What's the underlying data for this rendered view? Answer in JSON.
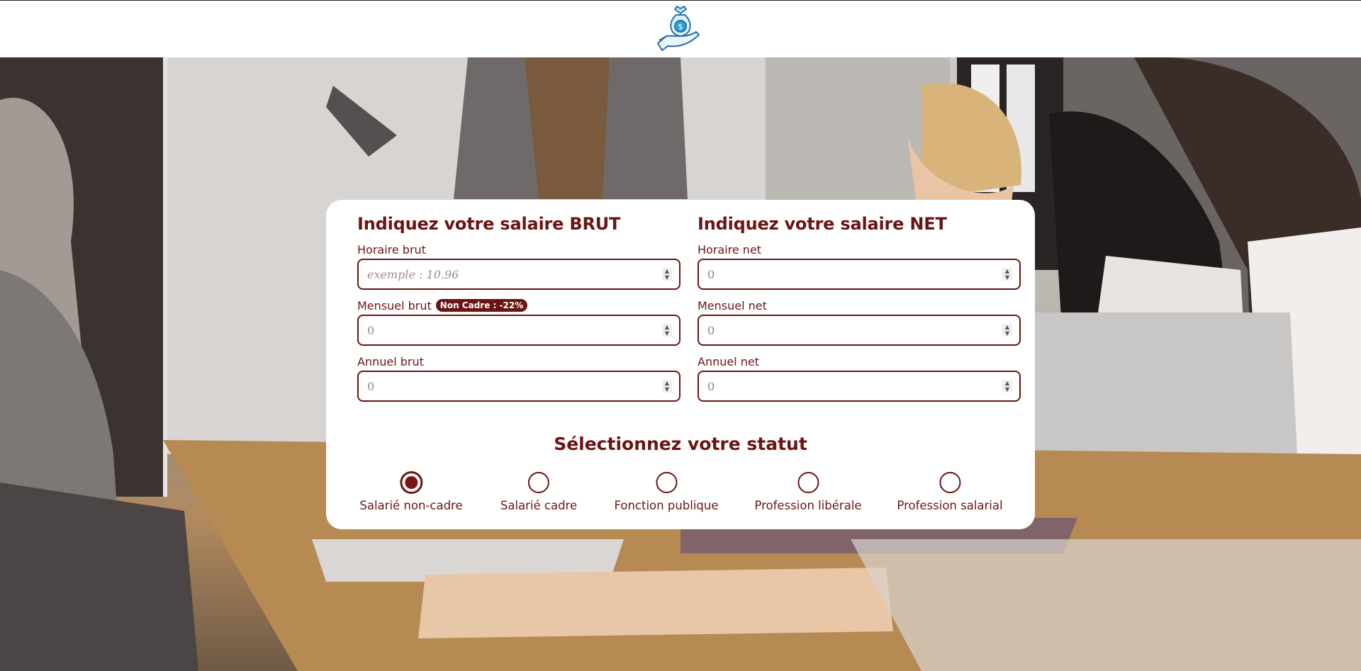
{
  "header": {
    "logo_icon": "money-bag-hand-icon"
  },
  "brut": {
    "title": "Indiquez votre salaire BRUT",
    "horaire": {
      "label": "Horaire brut",
      "placeholder": "exemple : 10.96"
    },
    "mensuel": {
      "label": "Mensuel brut",
      "badge": "Non Cadre : -22%",
      "placeholder": "0"
    },
    "annuel": {
      "label": "Annuel brut",
      "placeholder": "0"
    }
  },
  "net": {
    "title": "Indiquez votre salaire NET",
    "horaire": {
      "label": "Horaire net",
      "placeholder": "0"
    },
    "mensuel": {
      "label": "Mensuel net",
      "placeholder": "0"
    },
    "annuel": {
      "label": "Annuel net",
      "placeholder": "0"
    }
  },
  "statut": {
    "title": "Sélectionnez votre statut",
    "options": [
      {
        "label": "Salarié non-cadre",
        "checked": true
      },
      {
        "label": "Salarié cadre",
        "checked": false
      },
      {
        "label": "Fonction publique",
        "checked": false
      },
      {
        "label": "Profession libérale",
        "checked": false
      },
      {
        "label": "Profession salarial",
        "checked": false
      }
    ]
  },
  "colors": {
    "accent": "#6b1414",
    "logo": "#2a9fd6"
  }
}
